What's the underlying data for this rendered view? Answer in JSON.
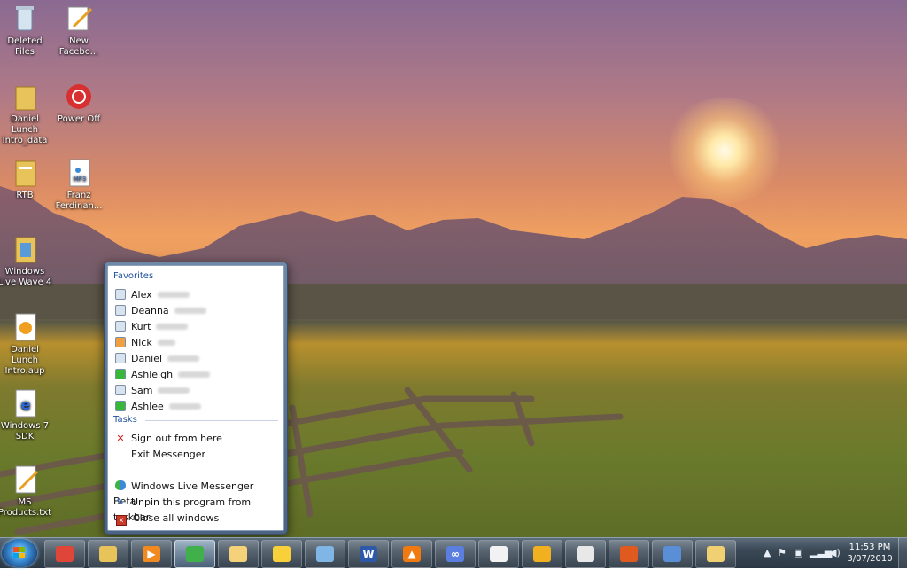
{
  "desktop": {
    "icons": [
      {
        "label": "Deleted Files"
      },
      {
        "label": "New\nFacebo..."
      },
      {
        "label": "Daniel Lunch\nIntro_data"
      },
      {
        "label": "Power Off"
      },
      {
        "label": "RTB"
      },
      {
        "label": "Franz\nFerdinan..."
      },
      {
        "label": "Windows\nLive Wave 4"
      },
      {
        "label": "Daniel Lunch\nIntro.aup"
      },
      {
        "label": "Windows 7\nSDK"
      },
      {
        "label": "MS\nProducts.txt"
      }
    ],
    "mp3_badge": "MP3"
  },
  "jumplist": {
    "favorites_header": "Favorites",
    "favorites": [
      {
        "name": "Alex",
        "status_color": "#d9e3ee"
      },
      {
        "name": "Deanna",
        "status_color": "#d9e3ee"
      },
      {
        "name": "Kurt",
        "status_color": "#d9e3ee"
      },
      {
        "name": "Nick",
        "status_color": "#f0a040"
      },
      {
        "name": "Daniel",
        "status_color": "#d9e3ee"
      },
      {
        "name": "Ashleigh",
        "status_color": "#38b838"
      },
      {
        "name": "Sam",
        "status_color": "#d9e3ee"
      },
      {
        "name": "Ashlee",
        "status_color": "#38b838"
      }
    ],
    "tasks_header": "Tasks",
    "tasks": [
      {
        "label": "Sign out from here",
        "icon": "red-x-icon"
      },
      {
        "label": "Exit Messenger",
        "icon": ""
      }
    ],
    "pinned": [
      {
        "label": "Windows Live Messenger Beta",
        "icon": "messenger-icon"
      },
      {
        "label": "Unpin this program from taskbar",
        "icon": "unpin-icon"
      },
      {
        "label": "Close all windows",
        "icon": "close-window-icon"
      }
    ]
  },
  "taskbar": {
    "buttons": [
      {
        "name": "chrome",
        "glyph": "",
        "color": "#e0453a"
      },
      {
        "name": "explorer",
        "glyph": "",
        "color": "#e8c35a"
      },
      {
        "name": "media-player",
        "glyph": "▶",
        "color": "#f08a20"
      },
      {
        "name": "messenger",
        "glyph": "",
        "color": "#3fb04a"
      },
      {
        "name": "outlook",
        "glyph": "",
        "color": "#f5d27a"
      },
      {
        "name": "thunderbird",
        "glyph": "",
        "color": "#f7d03a"
      },
      {
        "name": "remote-desktop",
        "glyph": "",
        "color": "#7fb6e6"
      },
      {
        "name": "word",
        "glyph": "W",
        "color": "#2c5aa8"
      },
      {
        "name": "vlc",
        "glyph": "▲",
        "color": "#f07a10"
      },
      {
        "name": "infinity-app",
        "glyph": "∞",
        "color": "#5a7fe0"
      },
      {
        "name": "notepad",
        "glyph": "",
        "color": "#f2f2f2"
      },
      {
        "name": "audacity",
        "glyph": "",
        "color": "#f0b020"
      },
      {
        "name": "paint",
        "glyph": "",
        "color": "#e8e8e8"
      },
      {
        "name": "office",
        "glyph": "",
        "color": "#e05a20"
      },
      {
        "name": "visual-studio",
        "glyph": "",
        "color": "#5a8fd8"
      },
      {
        "name": "folder-window",
        "glyph": "",
        "color": "#f0d070"
      }
    ],
    "clock": {
      "time": "11:53 PM",
      "date": "3/07/2010"
    }
  }
}
